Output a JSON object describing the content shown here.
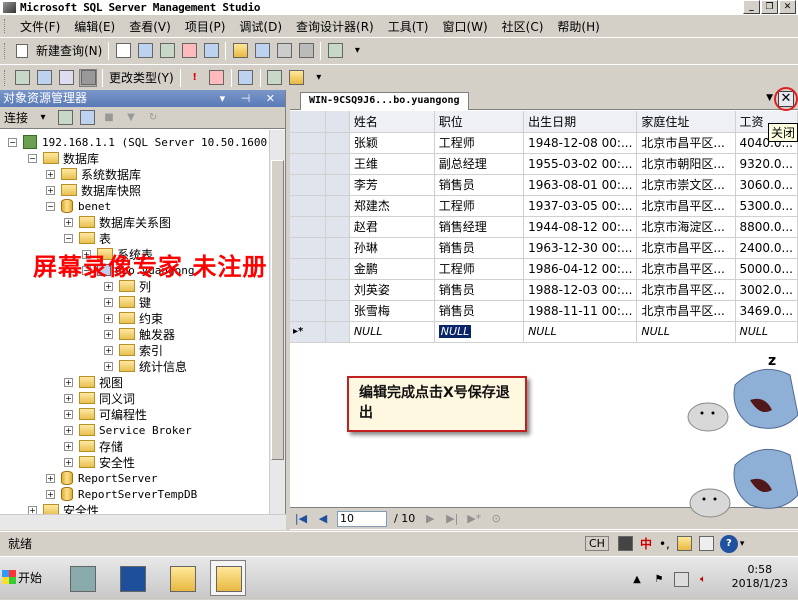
{
  "window": {
    "title": "Microsoft SQL Server Management Studio",
    "min": "_",
    "restore": "❐",
    "close": "✕"
  },
  "menu": [
    "文件(F)",
    "编辑(E)",
    "查看(V)",
    "项目(P)",
    "调试(D)",
    "查询设计器(R)",
    "工具(T)",
    "窗口(W)",
    "社区(C)",
    "帮助(H)"
  ],
  "toolbar1": {
    "new_query": "新建查询(N)"
  },
  "toolbar2": {
    "change_type": "更改类型(Y)"
  },
  "object_explorer": {
    "title": "对象资源管理器",
    "header_buttons": "▾ ⊣ ✕",
    "connect": "连接",
    "tree": [
      {
        "label": "192.168.1.1 (SQL Server 10.50.1600 -"
      },
      {
        "label": "数据库"
      },
      {
        "label": "系统数据库"
      },
      {
        "label": "数据库快照"
      },
      {
        "label": "benet"
      },
      {
        "label": "数据库关系图"
      },
      {
        "label": "表"
      },
      {
        "label": "系统表"
      },
      {
        "label": "dbo.yuangong"
      },
      {
        "label": "列"
      },
      {
        "label": "键"
      },
      {
        "label": "约束"
      },
      {
        "label": "触发器"
      },
      {
        "label": "索引"
      },
      {
        "label": "统计信息"
      },
      {
        "label": "视图"
      },
      {
        "label": "同义词"
      },
      {
        "label": "可编程性"
      },
      {
        "label": "Service Broker"
      },
      {
        "label": "存储"
      },
      {
        "label": "安全性"
      },
      {
        "label": "ReportServer"
      },
      {
        "label": "ReportServerTempDB"
      },
      {
        "label": "安全性"
      }
    ]
  },
  "watermark": "屏幕录像专家  未注册",
  "document": {
    "tab": "WIN-9CSQ9J6...bo.yuangong",
    "close_tooltip": "关闭",
    "columns": [
      "姓名",
      "职位",
      "出生日期",
      "家庭住址",
      "工资"
    ],
    "rows": [
      [
        "张颖",
        "工程师",
        "1948-12-08 00:...",
        "北京市昌平区...",
        "4040.0..."
      ],
      [
        "王维",
        "副总经理",
        "1955-03-02 00:...",
        "北京市朝阳区...",
        "9320.0..."
      ],
      [
        "李芳",
        "销售员",
        "1963-08-01 00:...",
        "北京市崇文区...",
        "3060.0..."
      ],
      [
        "郑建杰",
        "工程师",
        "1937-03-05 00:...",
        "北京市昌平区...",
        "5300.0..."
      ],
      [
        "赵君",
        "销售经理",
        "1944-08-12 00:...",
        "北京市海淀区...",
        "8800.0..."
      ],
      [
        "孙琳",
        "销售员",
        "1963-12-30 00:...",
        "北京市昌平区...",
        "2400.0..."
      ],
      [
        "金鹏",
        "工程师",
        "1986-04-12 00:...",
        "北京市昌平区...",
        "5000.0..."
      ],
      [
        "刘英姿",
        "销售员",
        "1988-12-03 00:...",
        "北京市昌平区...",
        "3002.0..."
      ],
      [
        "张雪梅",
        "销售员",
        "1988-11-11 00:...",
        "北京市昌平区...",
        "3469.0..."
      ]
    ],
    "null_row": [
      "NULL",
      "NULL",
      "NULL",
      "NULL",
      "NULL"
    ],
    "new_row_marker": "▸*",
    "nav": {
      "current": "10",
      "total": "/ 10"
    }
  },
  "note": "编辑完成点击X号保存退出",
  "status": {
    "text": "就绪",
    "ime": "CH",
    "ime_mode": "中"
  },
  "taskbar": {
    "start": "开始",
    "time": "0:58",
    "date": "2018/1/23"
  }
}
